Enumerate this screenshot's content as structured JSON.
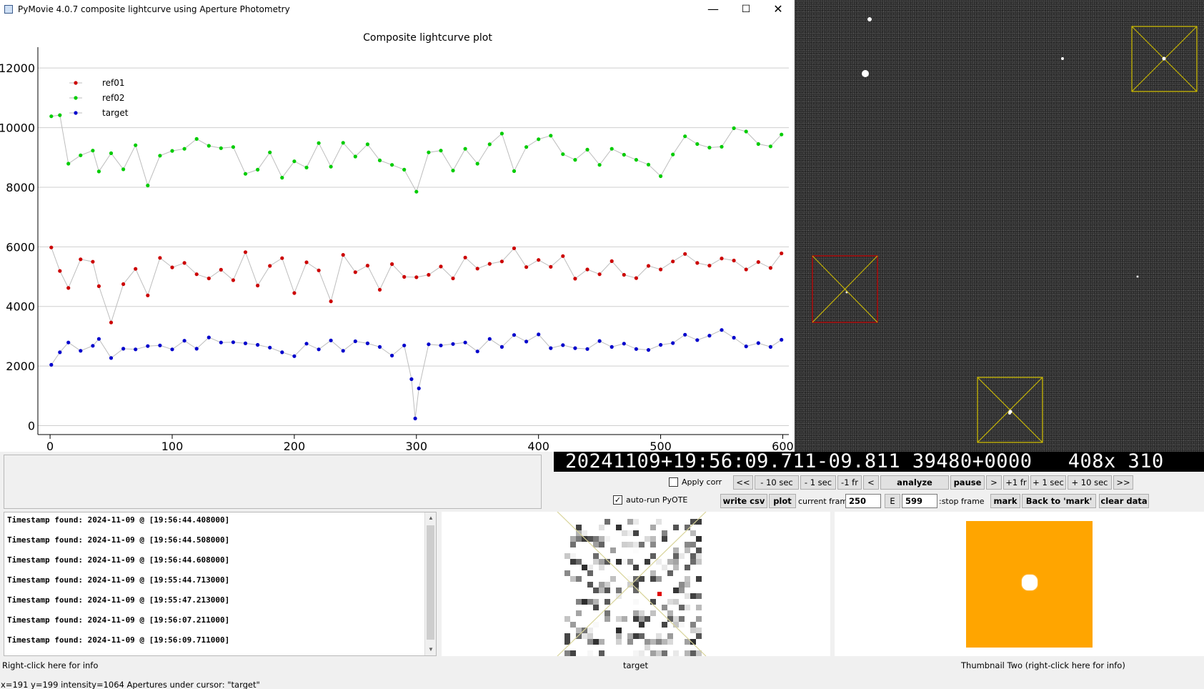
{
  "window": {
    "title": "PyMovie 4.0.7 composite lightcurve using Aperture Photometry",
    "min": "—",
    "max": "☐",
    "close": "✕"
  },
  "chart_data": {
    "type": "scatter",
    "title": "Composite lightcurve plot",
    "xlim": [
      -10,
      605
    ],
    "ylim": [
      -300,
      12700
    ],
    "xticks": [
      0,
      100,
      200,
      300,
      400,
      500,
      600
    ],
    "yticks": [
      0,
      2000,
      4000,
      6000,
      8000,
      10000,
      12000
    ],
    "grid": true,
    "legend_position": "top-left",
    "series": [
      {
        "name": "ref01",
        "color": "#cc0000",
        "points": [
          [
            1,
            5980
          ],
          [
            8,
            5190
          ],
          [
            15,
            4620
          ],
          [
            25,
            5580
          ],
          [
            35,
            5500
          ],
          [
            40,
            4680
          ],
          [
            50,
            3460
          ],
          [
            60,
            4750
          ],
          [
            70,
            5260
          ],
          [
            80,
            4370
          ],
          [
            90,
            5630
          ],
          [
            100,
            5310
          ],
          [
            110,
            5460
          ],
          [
            120,
            5080
          ],
          [
            130,
            4940
          ],
          [
            140,
            5230
          ],
          [
            150,
            4880
          ],
          [
            160,
            5820
          ],
          [
            170,
            4700
          ],
          [
            180,
            5360
          ],
          [
            190,
            5620
          ],
          [
            200,
            4450
          ],
          [
            210,
            5480
          ],
          [
            220,
            5210
          ],
          [
            230,
            4170
          ],
          [
            240,
            5730
          ],
          [
            250,
            5150
          ],
          [
            260,
            5370
          ],
          [
            270,
            4560
          ],
          [
            280,
            5420
          ],
          [
            290,
            4990
          ],
          [
            300,
            4980
          ],
          [
            310,
            5060
          ],
          [
            320,
            5340
          ],
          [
            330,
            4940
          ],
          [
            340,
            5640
          ],
          [
            350,
            5270
          ],
          [
            360,
            5430
          ],
          [
            370,
            5510
          ],
          [
            380,
            5950
          ],
          [
            390,
            5320
          ],
          [
            400,
            5560
          ],
          [
            410,
            5330
          ],
          [
            420,
            5690
          ],
          [
            430,
            4930
          ],
          [
            440,
            5240
          ],
          [
            450,
            5080
          ],
          [
            460,
            5520
          ],
          [
            470,
            5060
          ],
          [
            480,
            4950
          ],
          [
            490,
            5360
          ],
          [
            500,
            5240
          ],
          [
            510,
            5510
          ],
          [
            520,
            5760
          ],
          [
            530,
            5460
          ],
          [
            540,
            5370
          ],
          [
            550,
            5610
          ],
          [
            560,
            5540
          ],
          [
            570,
            5240
          ],
          [
            580,
            5490
          ],
          [
            590,
            5290
          ],
          [
            599,
            5780
          ]
        ]
      },
      {
        "name": "ref02",
        "color": "#00cc00",
        "points": [
          [
            1,
            10380
          ],
          [
            8,
            10420
          ],
          [
            15,
            8790
          ],
          [
            25,
            9070
          ],
          [
            35,
            9230
          ],
          [
            40,
            8530
          ],
          [
            50,
            9140
          ],
          [
            60,
            8600
          ],
          [
            70,
            9410
          ],
          [
            80,
            8060
          ],
          [
            90,
            9060
          ],
          [
            100,
            9220
          ],
          [
            110,
            9290
          ],
          [
            120,
            9620
          ],
          [
            130,
            9390
          ],
          [
            140,
            9310
          ],
          [
            150,
            9350
          ],
          [
            160,
            8450
          ],
          [
            170,
            8590
          ],
          [
            180,
            9170
          ],
          [
            190,
            8320
          ],
          [
            200,
            8870
          ],
          [
            210,
            8660
          ],
          [
            220,
            9480
          ],
          [
            230,
            8690
          ],
          [
            240,
            9490
          ],
          [
            250,
            9030
          ],
          [
            260,
            9440
          ],
          [
            270,
            8900
          ],
          [
            280,
            8750
          ],
          [
            290,
            8590
          ],
          [
            300,
            7850
          ],
          [
            310,
            9170
          ],
          [
            320,
            9230
          ],
          [
            330,
            8560
          ],
          [
            340,
            9290
          ],
          [
            350,
            8790
          ],
          [
            360,
            9440
          ],
          [
            370,
            9800
          ],
          [
            380,
            8540
          ],
          [
            390,
            9350
          ],
          [
            400,
            9610
          ],
          [
            410,
            9730
          ],
          [
            420,
            9110
          ],
          [
            430,
            8920
          ],
          [
            440,
            9260
          ],
          [
            450,
            8750
          ],
          [
            460,
            9290
          ],
          [
            470,
            9090
          ],
          [
            480,
            8920
          ],
          [
            490,
            8760
          ],
          [
            500,
            8370
          ],
          [
            510,
            9100
          ],
          [
            520,
            9710
          ],
          [
            530,
            9450
          ],
          [
            540,
            9330
          ],
          [
            550,
            9360
          ],
          [
            560,
            9980
          ],
          [
            570,
            9870
          ],
          [
            580,
            9450
          ],
          [
            590,
            9370
          ],
          [
            599,
            9770
          ]
        ]
      },
      {
        "name": "target",
        "color": "#0000cc",
        "points": [
          [
            1,
            2040
          ],
          [
            8,
            2460
          ],
          [
            15,
            2790
          ],
          [
            25,
            2510
          ],
          [
            35,
            2680
          ],
          [
            40,
            2910
          ],
          [
            50,
            2270
          ],
          [
            60,
            2580
          ],
          [
            70,
            2560
          ],
          [
            80,
            2670
          ],
          [
            90,
            2690
          ],
          [
            100,
            2560
          ],
          [
            110,
            2850
          ],
          [
            120,
            2580
          ],
          [
            130,
            2960
          ],
          [
            140,
            2790
          ],
          [
            150,
            2800
          ],
          [
            160,
            2760
          ],
          [
            170,
            2710
          ],
          [
            180,
            2620
          ],
          [
            190,
            2460
          ],
          [
            200,
            2330
          ],
          [
            210,
            2750
          ],
          [
            220,
            2560
          ],
          [
            230,
            2860
          ],
          [
            240,
            2510
          ],
          [
            250,
            2830
          ],
          [
            260,
            2760
          ],
          [
            270,
            2640
          ],
          [
            280,
            2350
          ],
          [
            290,
            2690
          ],
          [
            296,
            1560
          ],
          [
            299,
            240
          ],
          [
            302,
            1250
          ],
          [
            310,
            2730
          ],
          [
            320,
            2690
          ],
          [
            330,
            2740
          ],
          [
            340,
            2790
          ],
          [
            350,
            2490
          ],
          [
            360,
            2910
          ],
          [
            370,
            2640
          ],
          [
            380,
            3040
          ],
          [
            390,
            2820
          ],
          [
            400,
            3060
          ],
          [
            410,
            2600
          ],
          [
            420,
            2700
          ],
          [
            430,
            2600
          ],
          [
            440,
            2570
          ],
          [
            450,
            2840
          ],
          [
            460,
            2640
          ],
          [
            470,
            2750
          ],
          [
            480,
            2570
          ],
          [
            490,
            2540
          ],
          [
            500,
            2710
          ],
          [
            510,
            2770
          ],
          [
            520,
            3050
          ],
          [
            530,
            2870
          ],
          [
            540,
            3020
          ],
          [
            550,
            3210
          ],
          [
            560,
            2950
          ],
          [
            570,
            2660
          ],
          [
            580,
            2770
          ],
          [
            590,
            2640
          ],
          [
            599,
            2880
          ]
        ]
      }
    ]
  },
  "timestamp_bar": "20241109+19:56:09.711-09.811 39480+0000   408x 310",
  "controls": {
    "apply_corr_label": "Apply corr",
    "apply_corr_checked": "",
    "auto_run_label": "auto-run PyOTE",
    "auto_run_checked": "✓",
    "nav": [
      "<<",
      "- 10 sec",
      "- 1 sec",
      "-1 fr",
      "<"
    ],
    "analyze": "analyze",
    "pause": "pause",
    "nav_fwd": [
      ">",
      "+1 fr",
      "+ 1 sec",
      "+ 10 sec",
      ">>"
    ],
    "write_csv": "write csv",
    "plot": "plot",
    "current_frame_label": "current frame:",
    "current_frame_value": "250",
    "e_button": "E",
    "stop_frame_value": "599",
    "stop_frame_label": ":stop frame",
    "mark": "mark",
    "back_to_mark": "Back to 'mark'",
    "clear_data": "clear data"
  },
  "log": {
    "lines": [
      "Timestamp found: 2024-11-09 @ [19:56:44.408000]",
      "Timestamp found: 2024-11-09 @ [19:56:44.508000]",
      "Timestamp found: 2024-11-09 @ [19:56:44.608000]",
      "Timestamp found: 2024-11-09 @ [19:55:44.713000]",
      "Timestamp found: 2024-11-09 @ [19:55:47.213000]",
      "Timestamp found: 2024-11-09 @ [19:56:07.211000]",
      "Timestamp found: 2024-11-09 @ [19:56:09.711000]"
    ],
    "caption": "Right-click here for info"
  },
  "thumbnails": {
    "one_caption": "target",
    "two_caption": "Thumbnail Two (right-click here for info)"
  },
  "status": "x=191 y=199 intensity=1064   Apertures under cursor: \"target\""
}
